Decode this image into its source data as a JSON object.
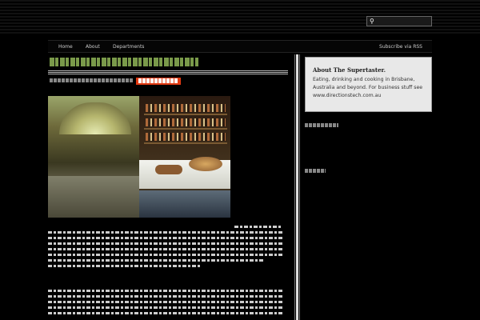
{
  "header": {
    "search": {
      "placeholder": "",
      "value": "",
      "icon": "search-icon"
    }
  },
  "nav": {
    "items": [
      {
        "label": "Home"
      },
      {
        "label": "About"
      },
      {
        "label": "Departments"
      }
    ],
    "rss_label": "Subscribe via RSS"
  },
  "sidebar": {
    "about": {
      "title": "About The Supertaster.",
      "text": "Eating, drinking and cooking in Brisbane, Australia and beyond. For business stuff see www.directionstech.com.au"
    }
  },
  "colors": {
    "accent": "#7a9a4a",
    "highlight": "#e23a12"
  }
}
